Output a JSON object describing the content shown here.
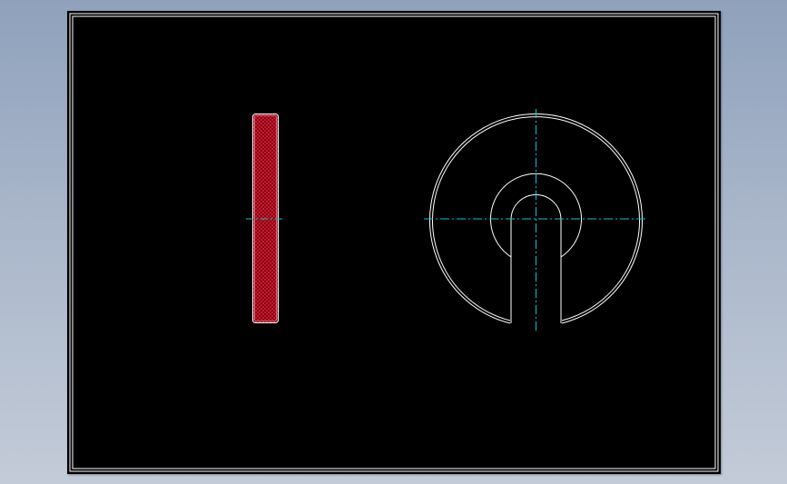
{
  "colors": {
    "background_gradient_top": "#8fa1bc",
    "background_gradient_bottom": "#c3cbd8",
    "sheet": "#000000",
    "border": "#ffffff",
    "outline": "#ffffff",
    "centerline": "#00c8d0",
    "section_hatch": "#c00020",
    "section_fill": "#7a0010"
  },
  "views": {
    "side_view": {
      "type": "section-view",
      "hatch": "cross-hatch"
    },
    "front_view": {
      "type": "c-washer-front-view",
      "features": [
        "outer-circle",
        "inner-circle",
        "slot-opening"
      ]
    }
  }
}
